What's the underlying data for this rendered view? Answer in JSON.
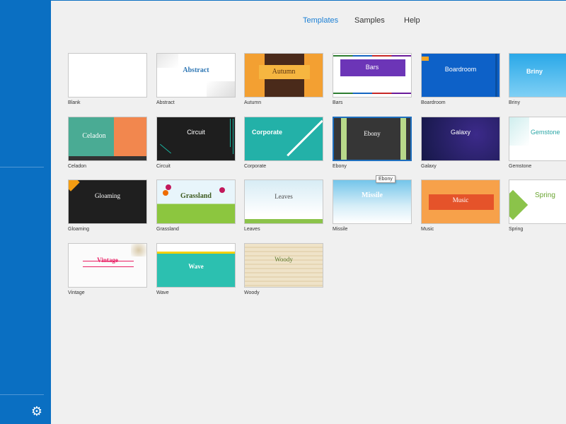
{
  "nav": {
    "tabs": [
      {
        "label": "Templates",
        "active": true
      },
      {
        "label": "Samples",
        "active": false
      },
      {
        "label": "Help",
        "active": false
      }
    ]
  },
  "templates": [
    {
      "name": "Blank",
      "title": ""
    },
    {
      "name": "Abstract",
      "title": "Abstract"
    },
    {
      "name": "Autumn",
      "title": "Autumn"
    },
    {
      "name": "Bars",
      "title": "Bars"
    },
    {
      "name": "Boardroom",
      "title": "Boardroom"
    },
    {
      "name": "Briny",
      "title": "Briny"
    },
    {
      "name": "Celadon",
      "title": "Celadon"
    },
    {
      "name": "Circuit",
      "title": "Circuit"
    },
    {
      "name": "Corporate",
      "title": "Corporate"
    },
    {
      "name": "Ebony",
      "title": "Ebony"
    },
    {
      "name": "Galaxy",
      "title": "Galaxy"
    },
    {
      "name": "Gemstone",
      "title": "Gemstone"
    },
    {
      "name": "Gloaming",
      "title": "Gloaming"
    },
    {
      "name": "Grassland",
      "title": "Grassland"
    },
    {
      "name": "Leaves",
      "title": "Leaves"
    },
    {
      "name": "Missile",
      "title": "Missile"
    },
    {
      "name": "Music",
      "title": "Music"
    },
    {
      "name": "Spring",
      "title": "Spring"
    },
    {
      "name": "Vintage",
      "title": "Vintage"
    },
    {
      "name": "Wave",
      "title": "Wave"
    },
    {
      "name": "Woody",
      "title": "Woody"
    }
  ],
  "selected_template": "Ebony",
  "tooltip": "Ebony",
  "sidebar": {
    "settings_icon": "gear-icon"
  },
  "colors": {
    "accent": "#1a7fd4",
    "sidebar": "#0a6fc2"
  }
}
